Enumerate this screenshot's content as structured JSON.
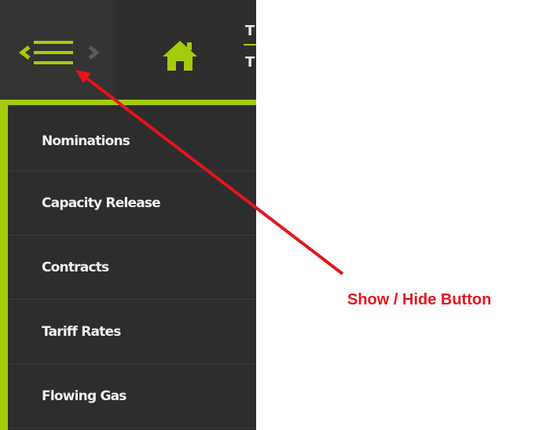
{
  "header": {
    "tabs": [
      {
        "label": "T"
      },
      {
        "label": "T"
      }
    ],
    "toggle_icon": "menu-chevrons-icon",
    "home_icon": "home-icon"
  },
  "sidebar": {
    "items": [
      {
        "label": "Nominations"
      },
      {
        "label": "Capacity Release"
      },
      {
        "label": "Contracts"
      },
      {
        "label": "Tariff Rates"
      },
      {
        "label": "Flowing Gas"
      }
    ]
  },
  "annotation": {
    "label": "Show / Hide Button",
    "color": "#e8141c"
  },
  "colors": {
    "accent": "#a4cc0a",
    "background": "#2d2d2d",
    "text": "#f2f2f2"
  }
}
